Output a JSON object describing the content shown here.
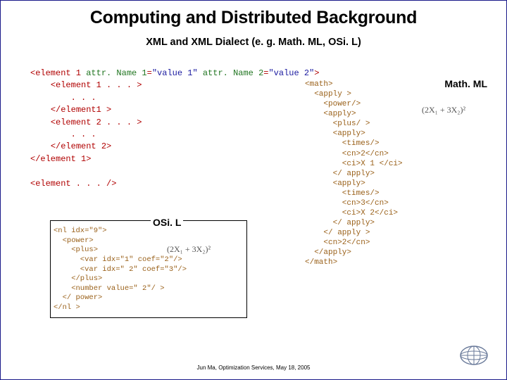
{
  "title": "Computing and  Distributed Background",
  "subtitle": "XML and XML Dialect (e. g. Math. ML, OSi. L)",
  "xml_schema": {
    "lines": [
      [
        [
          "tag",
          "<element 1"
        ],
        [
          "plain",
          " "
        ],
        [
          "attr",
          "attr. Name 1"
        ],
        [
          "sep",
          "="
        ],
        [
          "val",
          "\"value 1\""
        ],
        [
          "plain",
          " "
        ],
        [
          "attr",
          "attr. Name 2"
        ],
        [
          "sep",
          "="
        ],
        [
          "val",
          "\"value 2\""
        ],
        [
          "tag",
          ">"
        ]
      ],
      [
        [
          "plain",
          "    "
        ],
        [
          "tag",
          "<element 1 . . . >"
        ]
      ],
      [
        [
          "plain",
          "        "
        ],
        [
          "tag",
          ". . ."
        ]
      ],
      [
        [
          "plain",
          "    "
        ],
        [
          "tag",
          "</element1 >"
        ]
      ],
      [
        [
          "plain",
          "    "
        ],
        [
          "tag",
          "<element 2 . . . >"
        ]
      ],
      [
        [
          "plain",
          "        "
        ],
        [
          "tag",
          ". . ."
        ]
      ],
      [
        [
          "plain",
          "    "
        ],
        [
          "tag",
          "</element 2>"
        ]
      ],
      [
        [
          "tag",
          "</element 1>"
        ]
      ],
      [
        [
          "plain",
          " "
        ]
      ],
      [
        [
          "tag",
          "<element . . . />"
        ]
      ]
    ]
  },
  "mathml": {
    "label": "Math. ML",
    "formula": "(2X₁ + 3X₂)²",
    "code": "<math>\n  <apply >\n    <power/>\n    <apply>\n      <plus/ >\n      <apply>\n        <times/>\n        <cn>2</cn>\n        <ci>X 1 </ci>\n      </ apply>\n      <apply>\n        <times/>\n        <cn>3</cn>\n        <ci>X 2</ci>\n      </ apply>\n    </ apply >\n    <cn>2</cn>\n  </apply>\n</math>"
  },
  "osil": {
    "label": "OSi. L",
    "formula": "(2X₁ + 3X₂)²",
    "code": "<nl idx=\"9\">\n  <power>\n    <plus>\n      <var idx=\"1\" coef=\"2\"/>\n      <var idx=\" 2\" coef=\"3\"/>\n    </plus>\n    <number value=\" 2\"/ >\n  </ power>\n</nl >"
  },
  "footer": "Jun Ma, Optimization Services, May 18, 2005",
  "icons": {
    "globe": "globe-icon"
  }
}
